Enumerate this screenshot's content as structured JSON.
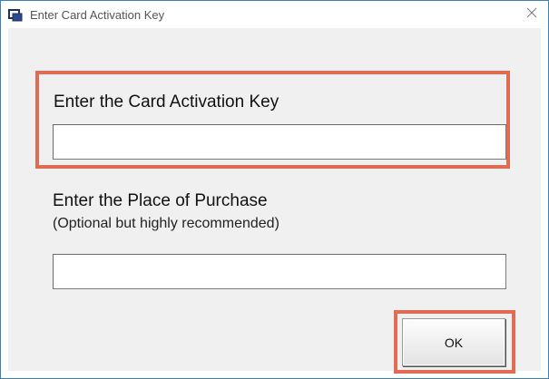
{
  "window": {
    "title": "Enter Card Activation Key",
    "close_glyph": "✕"
  },
  "form": {
    "activation_key_label": "Enter the Card Activation Key",
    "activation_key_value": "",
    "purchase_place_label": "Enter the Place of Purchase",
    "purchase_place_hint": "(Optional but highly recommended)",
    "purchase_place_value": ""
  },
  "buttons": {
    "ok_label": "OK"
  },
  "colors": {
    "highlight": "#e06c55",
    "window_border": "#3c7fb1",
    "dialog_background": "#f0f0f0"
  },
  "icons": {
    "title_icon": "app-card-icon",
    "close_icon": "close-icon"
  }
}
